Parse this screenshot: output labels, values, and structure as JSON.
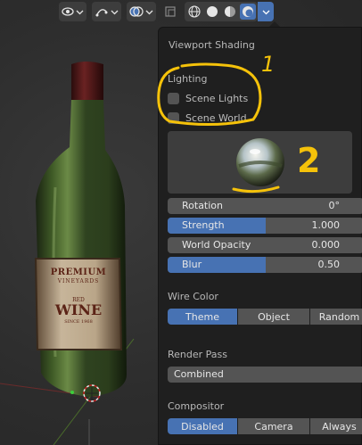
{
  "panel": {
    "title": "Viewport Shading",
    "lighting": {
      "label": "Lighting",
      "scene_lights": "Scene Lights",
      "scene_world": "Scene World"
    },
    "rotation": {
      "label": "Rotation",
      "value": "0°"
    },
    "strength": {
      "label": "Strength",
      "value": "1.000",
      "fraction": 0.5
    },
    "world_opacity": {
      "label": "World Opacity",
      "value": "0.000"
    },
    "blur": {
      "label": "Blur",
      "value": "0.50",
      "fraction": 0.5
    },
    "wire_color": {
      "label": "Wire Color",
      "options": [
        "Theme",
        "Object",
        "Random"
      ],
      "selected": "Theme"
    },
    "render_pass": {
      "label": "Render Pass",
      "value": "Combined"
    },
    "compositor": {
      "label": "Compositor",
      "options": [
        "Disabled",
        "Camera",
        "Always"
      ],
      "selected": "Disabled"
    }
  },
  "label": {
    "brand": "PREMIUM",
    "sub": "VINEYARDS",
    "red": "RED",
    "wine": "WINE",
    "since": "SINCE 1968"
  },
  "annotations": {
    "one": "1",
    "two": "2"
  },
  "colors": {
    "accent": "#4772b3",
    "annotation": "#f5c20a"
  }
}
